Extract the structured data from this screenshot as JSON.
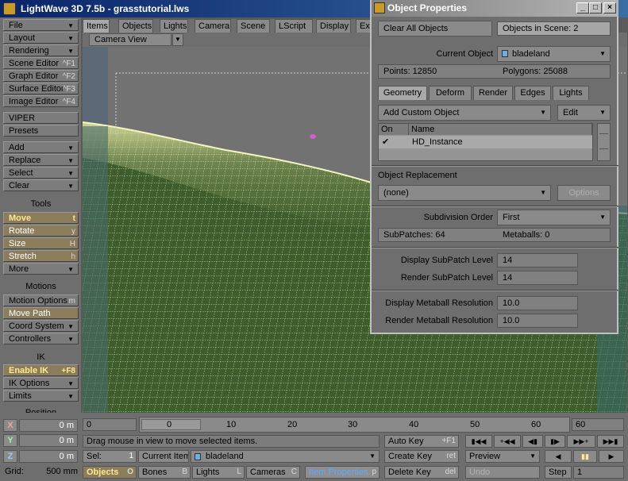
{
  "window": {
    "title": "LightWave 3D 7.5b - grasstutorial.lws"
  },
  "left": {
    "file": "File",
    "layout": "Layout",
    "rendering": "Rendering",
    "scene_editor": "Scene Editor",
    "scene_editor_sc": "^F1",
    "graph_editor": "Graph Editor",
    "graph_editor_sc": "^F2",
    "surface_editor": "Surface Editor",
    "surface_editor_sc": "^F3",
    "image_editor": "Image Editor",
    "image_editor_sc": "^F4",
    "viper": "VIPER",
    "presets": "Presets",
    "add": "Add",
    "replace": "Replace",
    "select": "Select",
    "clear": "Clear",
    "tools_header": "Tools",
    "move": "Move",
    "move_sc": "t",
    "rotate": "Rotate",
    "rotate_sc": "y",
    "size": "Size",
    "size_sc": "H",
    "stretch": "Stretch",
    "stretch_sc": "h",
    "more": "More",
    "motions_header": "Motions",
    "motion_options": "Motion Options",
    "motion_options_sc": "m",
    "move_path": "Move Path",
    "coord_system": "Coord System",
    "controllers": "Controllers",
    "ik_header": "IK",
    "enable_ik": "Enable IK",
    "enable_ik_sc": "+F8",
    "ik_options": "IK Options",
    "limits": "Limits",
    "position_header": "Position"
  },
  "tabs": [
    "Items",
    "Objects",
    "Lights",
    "Camera",
    "Scene",
    "LScript",
    "Display",
    "Ex"
  ],
  "viewport": {
    "view_mode": "Camera View"
  },
  "object_properties": {
    "title": "Object Properties",
    "clear_all": "Clear All Objects",
    "objects_in_scene": "Objects in Scene: 2",
    "current_object_label": "Current Object",
    "current_object": "bladeland",
    "points": "Points: 12850",
    "polygons": "Polygons: 25088",
    "tabs": [
      "Geometry",
      "Deform",
      "Render",
      "Edges",
      "Lights"
    ],
    "add_custom": "Add Custom Object",
    "edit": "Edit",
    "col_on": "On",
    "col_name": "Name",
    "check": "✔",
    "row_name": "HD_Instance",
    "replacement_label": "Object Replacement",
    "replacement_value": "(none)",
    "options": "Options",
    "subdiv_order_label": "Subdivision Order",
    "subdiv_order": "First",
    "subpatches": "SubPatches: 64",
    "metaballs": "Metaballs: 0",
    "display_subpatch_label": "Display SubPatch Level",
    "display_subpatch": "14",
    "render_subpatch_label": "Render SubPatch Level",
    "render_subpatch": "14",
    "display_meta_label": "Display Metaball Resolution",
    "display_meta": "10.0",
    "render_meta_label": "Render Metaball Resolution",
    "render_meta": "10.0"
  },
  "bottom": {
    "x": "X",
    "y": "Y",
    "z": "Z",
    "x_val": "0 m",
    "y_val": "0 m",
    "z_val": "0 m",
    "grid": "Grid:",
    "grid_val": "500 mm",
    "start_frame": "0",
    "end_frame": "60",
    "ticks": [
      "0",
      "10",
      "20",
      "30",
      "40",
      "50",
      "60"
    ],
    "status": "Drag mouse in view to move selected items.",
    "sel_label": "Sel:",
    "sel_val": "1",
    "current_item_label": "Current Item",
    "current_item": "bladeland",
    "objects": "Objects",
    "objects_sc": "O",
    "bones": "Bones",
    "bones_sc": "B",
    "lights": "Lights",
    "lights_sc": "L",
    "cameras": "Cameras",
    "cameras_sc": "C",
    "item_properties": "Item Properties",
    "item_properties_sc": "p",
    "auto_key": "Auto Key",
    "auto_key_sc": "+F1",
    "create_key": "Create Key",
    "create_key_sc": "ret",
    "delete_key": "Delete Key",
    "delete_key_sc": "del",
    "preview": "Preview",
    "undo": "Undo",
    "step": "Step",
    "step_val": "1"
  }
}
